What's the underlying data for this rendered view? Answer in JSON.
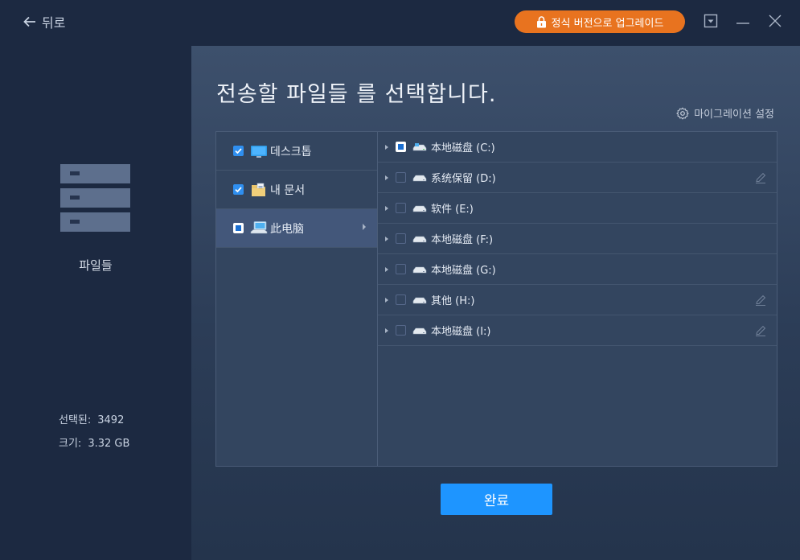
{
  "header": {
    "back_label": "뒤로",
    "upgrade_label": "정식 버전으로 업그레이드",
    "accent_color": "#e8731f"
  },
  "sidebar": {
    "label": "파일들",
    "selected_label": "선택된:",
    "selected_value": "3492",
    "size_label": "크기:",
    "size_value": "3.32 GB"
  },
  "main": {
    "heading": "전송할 파일들 를 선택합니다.",
    "settings_label": "마이그레이션 설정",
    "done_label": "완료"
  },
  "categories": [
    {
      "label": "데스크톱",
      "state": "checked",
      "icon": "desktop-icon"
    },
    {
      "label": "내 문서",
      "state": "checked",
      "icon": "documents-folder-icon"
    },
    {
      "label": "此电脑",
      "state": "partial",
      "icon": "computer-icon",
      "active": true
    }
  ],
  "drives": [
    {
      "label": "本地磁盘 (C:)",
      "state": "partial",
      "system": true,
      "editable": false
    },
    {
      "label": "系统保留 (D:)",
      "state": "empty",
      "system": false,
      "editable": true
    },
    {
      "label": "软件 (E:)",
      "state": "empty",
      "system": false,
      "editable": false
    },
    {
      "label": "本地磁盘 (F:)",
      "state": "empty",
      "system": false,
      "editable": false
    },
    {
      "label": "本地磁盘 (G:)",
      "state": "empty",
      "system": false,
      "editable": false
    },
    {
      "label": "其他 (H:)",
      "state": "empty",
      "system": false,
      "editable": true
    },
    {
      "label": "本地磁盘 (I:)",
      "state": "empty",
      "system": false,
      "editable": true
    }
  ]
}
